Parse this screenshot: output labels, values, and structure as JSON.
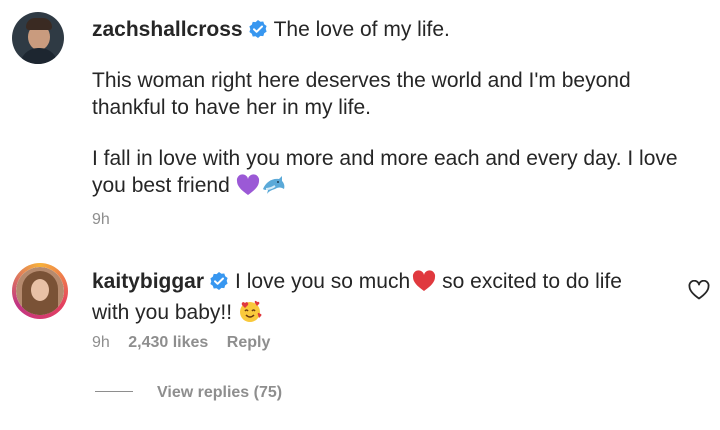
{
  "caption": {
    "username": "zachshallcross",
    "first_line": "The love of my life.",
    "paragraph1_line1": "This woman right here deserves the world and I'm beyond",
    "paragraph1_line2": "thankful to have her in my life.",
    "paragraph2_line1": "I fall in love with you more and more each and every day. I love",
    "paragraph2_line2": "you best friend",
    "time": "9h",
    "emojis": [
      "purple-heart-icon",
      "dolphin-icon"
    ]
  },
  "comment": {
    "username": "kaitybiggar",
    "text_part1": "I love you so much",
    "text_part2": "so excited to do life",
    "text_line2": "with you baby!!",
    "time": "9h",
    "likes": "2,430 likes",
    "reply_label": "Reply",
    "view_replies": "View replies (75)",
    "emojis": [
      "red-heart-icon",
      "smiling-face-with-hearts-icon"
    ]
  },
  "colors": {
    "verified": "#3897f0",
    "secondary_text": "#8e8e8e",
    "primary_text": "#262626"
  }
}
